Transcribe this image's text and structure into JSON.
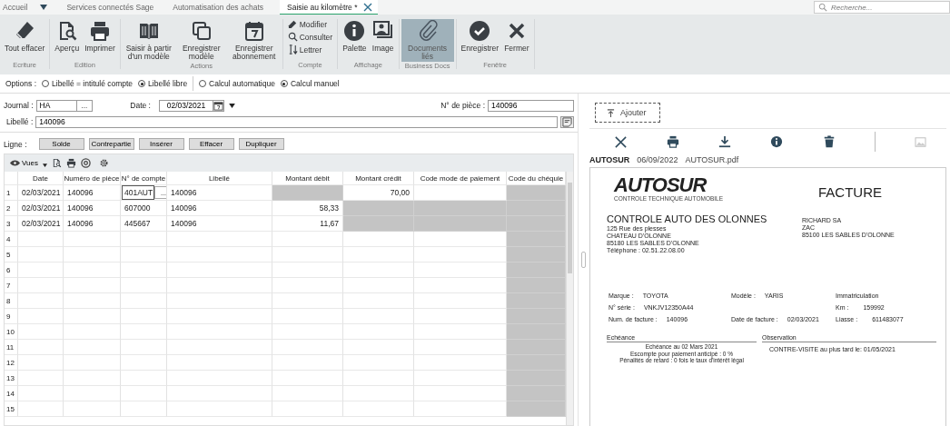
{
  "tabs": [
    {
      "label": "Accueil",
      "selected": false,
      "kind": "menu"
    },
    {
      "label": "Services connectés Sage",
      "selected": false,
      "kind": "plain"
    },
    {
      "label": "Automatisation des achats",
      "selected": false,
      "kind": "plain"
    },
    {
      "label": "Saisie au kilomètre *",
      "selected": true,
      "kind": "closable"
    }
  ],
  "search": {
    "placeholder": "Recherche..."
  },
  "ribbon": {
    "groups": [
      {
        "label": "Ecriture",
        "kind": "large",
        "buttons": [
          {
            "label": "Tout effacer",
            "selected": false
          }
        ]
      },
      {
        "label": "Edition",
        "kind": "large",
        "buttons": [
          {
            "label": "Aperçu",
            "selected": false
          },
          {
            "label": "Imprimer",
            "selected": false
          }
        ]
      },
      {
        "label": "Actions",
        "kind": "large",
        "buttons": [
          {
            "label": "Saisir à partir d'un modèle",
            "selected": false
          },
          {
            "label": "Enregistrer modèle",
            "selected": false
          },
          {
            "label": "Enregistrer abonnement",
            "selected": false
          }
        ]
      },
      {
        "label": "Compte",
        "kind": "small",
        "buttons": [
          {
            "label": "Modifier",
            "selected": false
          },
          {
            "label": "Consulter",
            "selected": false
          },
          {
            "label": "Lettrer",
            "selected": false
          }
        ]
      },
      {
        "label": "Affichage",
        "kind": "large",
        "buttons": [
          {
            "label": "Palette",
            "selected": false
          },
          {
            "label": "Image",
            "selected": false
          }
        ]
      },
      {
        "label": "Business Docs",
        "kind": "large",
        "buttons": [
          {
            "label": "Documents liés",
            "selected": true
          }
        ]
      },
      {
        "label": "Fenêtre",
        "kind": "large",
        "buttons": [
          {
            "label": "Enregistrer",
            "selected": false
          },
          {
            "label": "Fermer",
            "selected": false
          }
        ]
      }
    ]
  },
  "options": {
    "label": "Options :",
    "groups": [
      [
        {
          "label": "Libellé = intitulé compte",
          "selected": false
        },
        {
          "label": "Libellé libre",
          "selected": true
        }
      ],
      [
        {
          "label": "Calcul automatique",
          "selected": false
        },
        {
          "label": "Calcul manuel",
          "selected": true
        }
      ]
    ]
  },
  "form": {
    "journal": {
      "label": "Journal :",
      "value": "HA",
      "button": "..."
    },
    "date": {
      "label": "Date :",
      "value": "02/03/2021"
    },
    "piece": {
      "label": "N° de pièce :",
      "value": "140096"
    },
    "libelle": {
      "label": "Libellé :",
      "value": "140096"
    }
  },
  "line_actions": {
    "label": "Ligne :",
    "buttons": [
      "Solde",
      "Contrepartie",
      "Insérer",
      "Effacer",
      "Dupliquer"
    ]
  },
  "grid_toolbar": {
    "views": "Vues"
  },
  "table": {
    "columns": [
      {
        "label": "Date",
        "kind": "text"
      },
      {
        "label": "Numéro de pièce",
        "kind": "text"
      },
      {
        "label": "N° de compte",
        "kind": "text"
      },
      {
        "label": "Libellé",
        "kind": "text"
      },
      {
        "label": "Montant débit",
        "kind": "amount"
      },
      {
        "label": "Montant crédit",
        "kind": "amount"
      },
      {
        "label": "Code mode de paiement",
        "kind": "text"
      },
      {
        "label": "Code du chéquie",
        "kind": "text"
      }
    ],
    "rows": [
      {
        "number": "1",
        "cells": [
          {
            "kind": "text",
            "text": "02/03/2021",
            "shaded": false
          },
          {
            "kind": "text",
            "text": "140096",
            "shaded": false
          },
          {
            "kind": "input",
            "text": "401AUT",
            "button": "...",
            "shaded": false
          },
          {
            "kind": "text",
            "text": "140096",
            "shaded": false
          },
          {
            "kind": "text",
            "shaded": true
          },
          {
            "kind": "text",
            "text": "70,00",
            "shaded": false
          },
          {
            "kind": "text",
            "shaded": false
          },
          {
            "kind": "text",
            "shaded": true
          }
        ]
      },
      {
        "number": "2",
        "cells": [
          {
            "kind": "text",
            "text": "02/03/2021",
            "shaded": false
          },
          {
            "kind": "text",
            "text": "140096",
            "shaded": false
          },
          {
            "kind": "text",
            "text": "607000",
            "shaded": false
          },
          {
            "kind": "text",
            "text": "140096",
            "shaded": false
          },
          {
            "kind": "text",
            "text": "58,33",
            "shaded": false
          },
          {
            "kind": "text",
            "shaded": true
          },
          {
            "kind": "text",
            "shaded": true
          },
          {
            "kind": "text",
            "shaded": true
          }
        ]
      },
      {
        "number": "3",
        "cells": [
          {
            "kind": "text",
            "text": "02/03/2021",
            "shaded": false
          },
          {
            "kind": "text",
            "text": "140096",
            "shaded": false
          },
          {
            "kind": "text",
            "text": "445667",
            "shaded": false
          },
          {
            "kind": "text",
            "text": "140096",
            "shaded": false
          },
          {
            "kind": "text",
            "text": "11,67",
            "shaded": false
          },
          {
            "kind": "text",
            "shaded": true
          },
          {
            "kind": "text",
            "shaded": true
          },
          {
            "kind": "text",
            "shaded": true
          }
        ]
      },
      {
        "number": "4",
        "cells": [
          {
            "kind": "text",
            "shaded": false
          },
          {
            "kind": "text",
            "shaded": false
          },
          {
            "kind": "text",
            "shaded": false
          },
          {
            "kind": "text",
            "shaded": false
          },
          {
            "kind": "text",
            "shaded": false
          },
          {
            "kind": "text",
            "shaded": false
          },
          {
            "kind": "text",
            "shaded": false
          },
          {
            "kind": "text",
            "shaded": true
          }
        ]
      },
      {
        "number": "5",
        "cells": [
          {
            "kind": "text",
            "shaded": false
          },
          {
            "kind": "text",
            "shaded": false
          },
          {
            "kind": "text",
            "shaded": false
          },
          {
            "kind": "text",
            "shaded": false
          },
          {
            "kind": "text",
            "shaded": false
          },
          {
            "kind": "text",
            "shaded": false
          },
          {
            "kind": "text",
            "shaded": false
          },
          {
            "kind": "text",
            "shaded": true
          }
        ]
      },
      {
        "number": "6",
        "cells": [
          {
            "kind": "text",
            "shaded": false
          },
          {
            "kind": "text",
            "shaded": false
          },
          {
            "kind": "text",
            "shaded": false
          },
          {
            "kind": "text",
            "shaded": false
          },
          {
            "kind": "text",
            "shaded": false
          },
          {
            "kind": "text",
            "shaded": false
          },
          {
            "kind": "text",
            "shaded": false
          },
          {
            "kind": "text",
            "shaded": true
          }
        ]
      },
      {
        "number": "7",
        "cells": [
          {
            "kind": "text",
            "shaded": false
          },
          {
            "kind": "text",
            "shaded": false
          },
          {
            "kind": "text",
            "shaded": false
          },
          {
            "kind": "text",
            "shaded": false
          },
          {
            "kind": "text",
            "shaded": false
          },
          {
            "kind": "text",
            "shaded": false
          },
          {
            "kind": "text",
            "shaded": false
          },
          {
            "kind": "text",
            "shaded": true
          }
        ]
      },
      {
        "number": "8",
        "cells": [
          {
            "kind": "text",
            "shaded": false
          },
          {
            "kind": "text",
            "shaded": false
          },
          {
            "kind": "text",
            "shaded": false
          },
          {
            "kind": "text",
            "shaded": false
          },
          {
            "kind": "text",
            "shaded": false
          },
          {
            "kind": "text",
            "shaded": false
          },
          {
            "kind": "text",
            "shaded": false
          },
          {
            "kind": "text",
            "shaded": true
          }
        ]
      },
      {
        "number": "9",
        "cells": [
          {
            "kind": "text",
            "shaded": false
          },
          {
            "kind": "text",
            "shaded": false
          },
          {
            "kind": "text",
            "shaded": false
          },
          {
            "kind": "text",
            "shaded": false
          },
          {
            "kind": "text",
            "shaded": false
          },
          {
            "kind": "text",
            "shaded": false
          },
          {
            "kind": "text",
            "shaded": false
          },
          {
            "kind": "text",
            "shaded": true
          }
        ]
      },
      {
        "number": "10",
        "cells": [
          {
            "kind": "text",
            "shaded": false
          },
          {
            "kind": "text",
            "shaded": false
          },
          {
            "kind": "text",
            "shaded": false
          },
          {
            "kind": "text",
            "shaded": false
          },
          {
            "kind": "text",
            "shaded": false
          },
          {
            "kind": "text",
            "shaded": false
          },
          {
            "kind": "text",
            "shaded": false
          },
          {
            "kind": "text",
            "shaded": true
          }
        ]
      },
      {
        "number": "11",
        "cells": [
          {
            "kind": "text",
            "shaded": false
          },
          {
            "kind": "text",
            "shaded": false
          },
          {
            "kind": "text",
            "shaded": false
          },
          {
            "kind": "text",
            "shaded": false
          },
          {
            "kind": "text",
            "shaded": false
          },
          {
            "kind": "text",
            "shaded": false
          },
          {
            "kind": "text",
            "shaded": false
          },
          {
            "kind": "text",
            "shaded": true
          }
        ]
      },
      {
        "number": "12",
        "cells": [
          {
            "kind": "text",
            "shaded": false
          },
          {
            "kind": "text",
            "shaded": false
          },
          {
            "kind": "text",
            "shaded": false
          },
          {
            "kind": "text",
            "shaded": false
          },
          {
            "kind": "text",
            "shaded": false
          },
          {
            "kind": "text",
            "shaded": false
          },
          {
            "kind": "text",
            "shaded": false
          },
          {
            "kind": "text",
            "shaded": true
          }
        ]
      },
      {
        "number": "13",
        "cells": [
          {
            "kind": "text",
            "shaded": false
          },
          {
            "kind": "text",
            "shaded": false
          },
          {
            "kind": "text",
            "shaded": false
          },
          {
            "kind": "text",
            "shaded": false
          },
          {
            "kind": "text",
            "shaded": false
          },
          {
            "kind": "text",
            "shaded": false
          },
          {
            "kind": "text",
            "shaded": false
          },
          {
            "kind": "text",
            "shaded": true
          }
        ]
      },
      {
        "number": "14",
        "cells": [
          {
            "kind": "text",
            "shaded": false
          },
          {
            "kind": "text",
            "shaded": false
          },
          {
            "kind": "text",
            "shaded": false
          },
          {
            "kind": "text",
            "shaded": false
          },
          {
            "kind": "text",
            "shaded": false
          },
          {
            "kind": "text",
            "shaded": false
          },
          {
            "kind": "text",
            "shaded": false
          },
          {
            "kind": "text",
            "shaded": true
          }
        ]
      },
      {
        "number": "15",
        "cells": [
          {
            "kind": "text",
            "shaded": false
          },
          {
            "kind": "text",
            "shaded": false
          },
          {
            "kind": "text",
            "shaded": false
          },
          {
            "kind": "text",
            "shaded": false
          },
          {
            "kind": "text",
            "shaded": false
          },
          {
            "kind": "text",
            "shaded": false
          },
          {
            "kind": "text",
            "shaded": false
          },
          {
            "kind": "text",
            "shaded": true
          }
        ]
      }
    ]
  },
  "documents": {
    "add_button": "Ajouter",
    "file": {
      "source": "AUTOSUR",
      "date": "06/09/2022",
      "name": "AUTOSUR.pdf"
    },
    "preview": {
      "logo": "AUTOSUR",
      "tagline": "CONTROLE TECHNIQUE AUTOMOBILE",
      "title": "FACTURE",
      "seller": {
        "name": "CONTROLE AUTO DES OLONNES",
        "lines": [
          "125  Rue des plesses",
          "CHATEAU D'OLONNE",
          "85180    LES SABLES D'OLONNE",
          "Téléphone :  02.51.22.08.00"
        ]
      },
      "buyer": [
        "RICHARD SA",
        "ZAC",
        "85100 LES SABLES D'OLONNE"
      ],
      "details": [
        {
          "left": {
            "label": "Marque :",
            "value": "TOYOTA"
          },
          "middle": {
            "label": "Modèle :",
            "value": "YARIS"
          },
          "right": {
            "label": "Immatriculation"
          }
        },
        {
          "left": {
            "label": "N° série :",
            "value": "VNKJV12350A44"
          },
          "right": {
            "label": "Km :",
            "value": "159992"
          }
        },
        {
          "left": {
            "label": "Num. de facture :",
            "value": "140096"
          },
          "middle": {
            "label": "Date de facture :",
            "value": "02/03/2021"
          },
          "right": {
            "label": "Liasse :",
            "value": "611483077"
          }
        }
      ],
      "due": {
        "title": "Echéance",
        "lines": [
          "Echéance au 02 Mars 2021",
          "Escompte pour paiement anticipé : 0 %",
          "Pénalités de retard : 0 fois le taux d'intérêt légal"
        ]
      },
      "observation": {
        "title": "Observation",
        "text": "CONTRE-VISITE au plus tard le: 01/05/2021"
      }
    }
  }
}
